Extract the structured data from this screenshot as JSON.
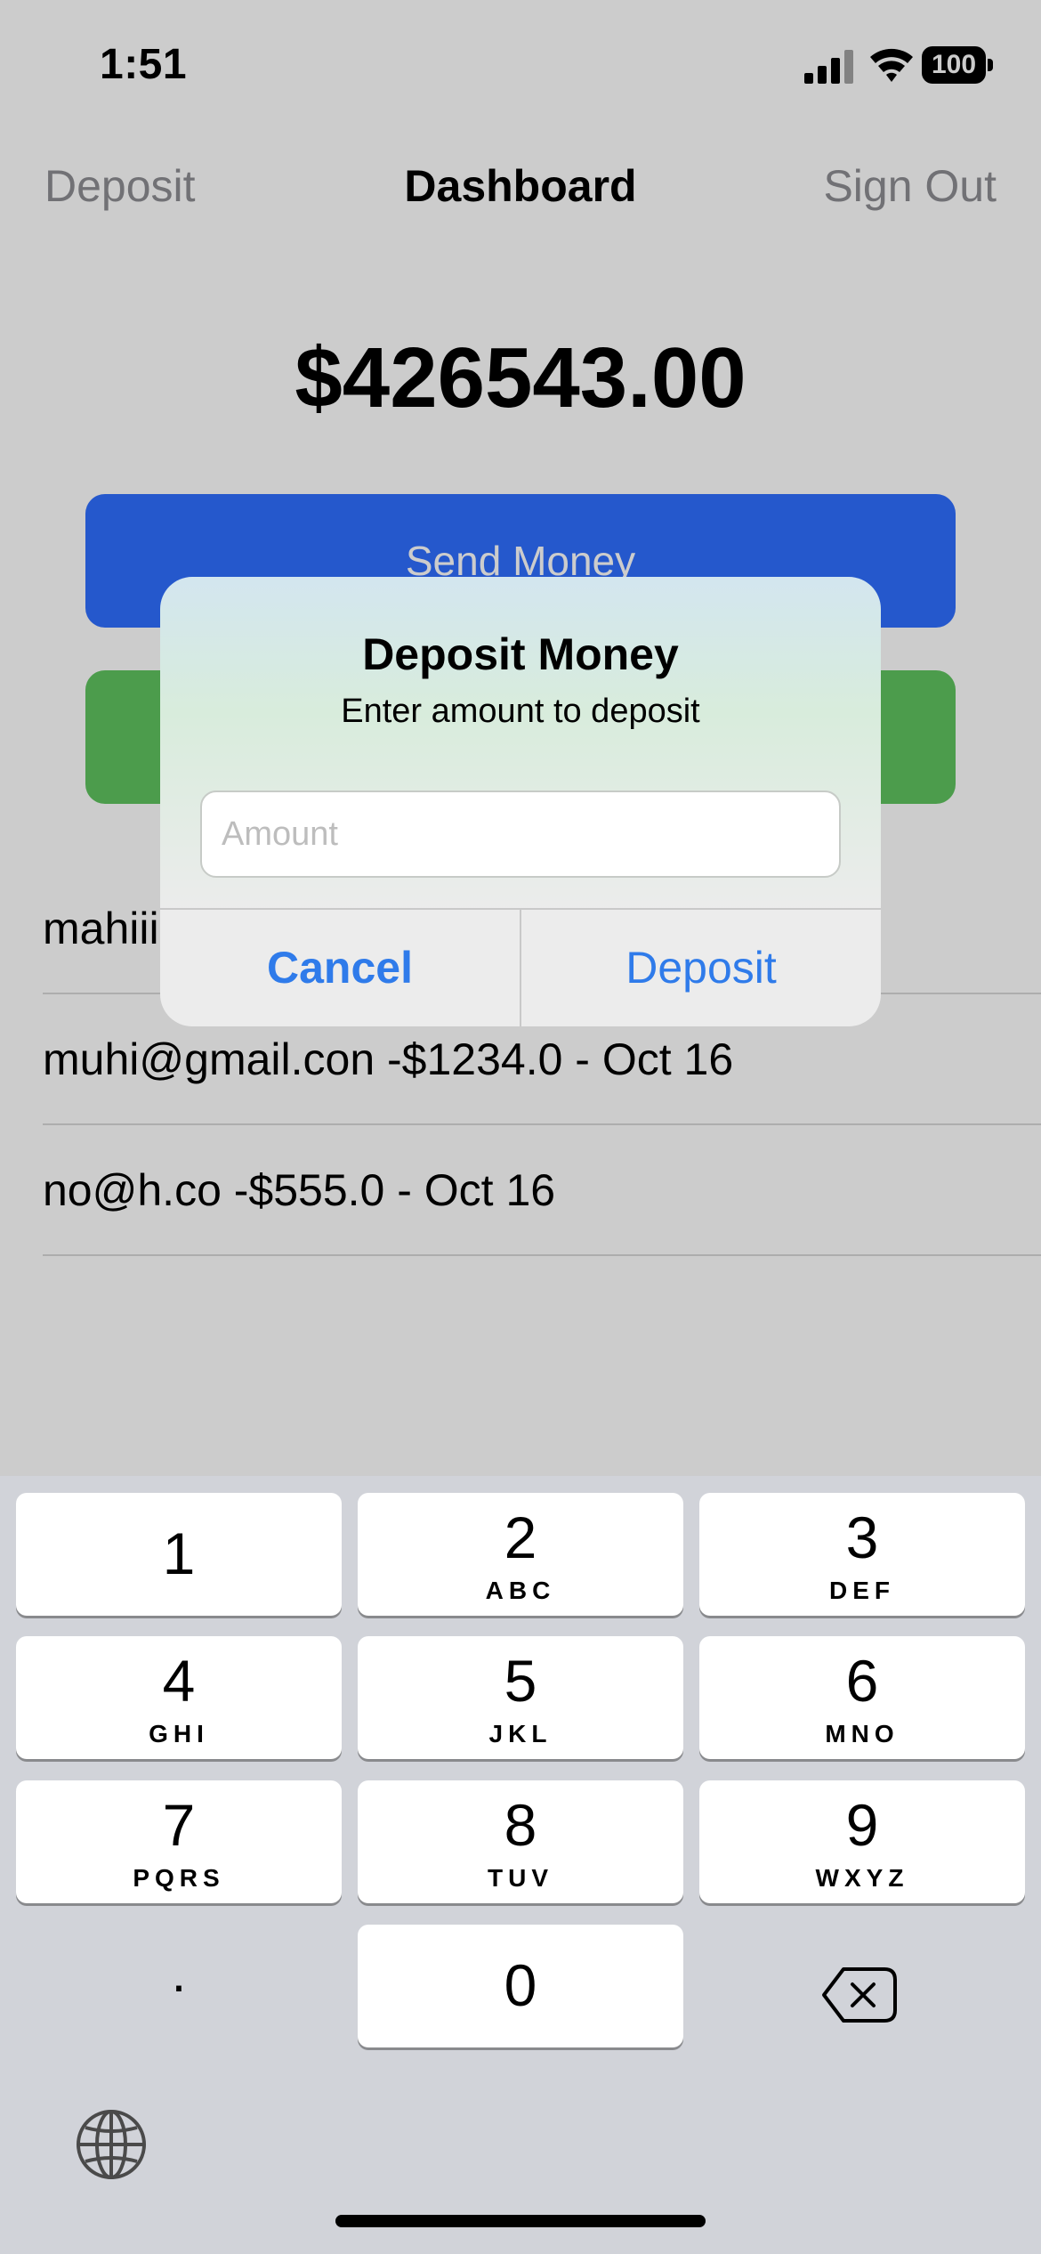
{
  "status_bar": {
    "time": "1:51",
    "battery": "100",
    "icons": [
      "signal-icon",
      "wifi-icon",
      "battery-icon"
    ]
  },
  "nav": {
    "left": "Deposit",
    "title": "Dashboard",
    "right": "Sign Out"
  },
  "balance": "$426543.00",
  "buttons": {
    "send_money": "Send Money"
  },
  "transactions": [
    "mahiii",
    "muhi@gmail.con -$1234.0 - Oct 16",
    "no@h.co -$555.0 - Oct 16"
  ],
  "alert": {
    "title": "Deposit Money",
    "message": "Enter amount to deposit",
    "input_placeholder": "Amount",
    "input_value": "",
    "cancel": "Cancel",
    "confirm": "Deposit"
  },
  "keyboard": {
    "keys": [
      {
        "digit": "1",
        "letters": ""
      },
      {
        "digit": "2",
        "letters": "ABC"
      },
      {
        "digit": "3",
        "letters": "DEF"
      },
      {
        "digit": "4",
        "letters": "GHI"
      },
      {
        "digit": "5",
        "letters": "JKL"
      },
      {
        "digit": "6",
        "letters": "MNO"
      },
      {
        "digit": "7",
        "letters": "PQRS"
      },
      {
        "digit": "8",
        "letters": "TUV"
      },
      {
        "digit": "9",
        "letters": "WXYZ"
      },
      {
        "digit": "0",
        "letters": ""
      }
    ],
    "decimal": ".",
    "icons": [
      "backspace-icon",
      "globe-icon"
    ]
  },
  "colors": {
    "send_button": "#2f6fff",
    "green_button": "#5fc45f",
    "alert_action": "#2f7bea",
    "keyboard_bg": "#d1d3d9"
  }
}
